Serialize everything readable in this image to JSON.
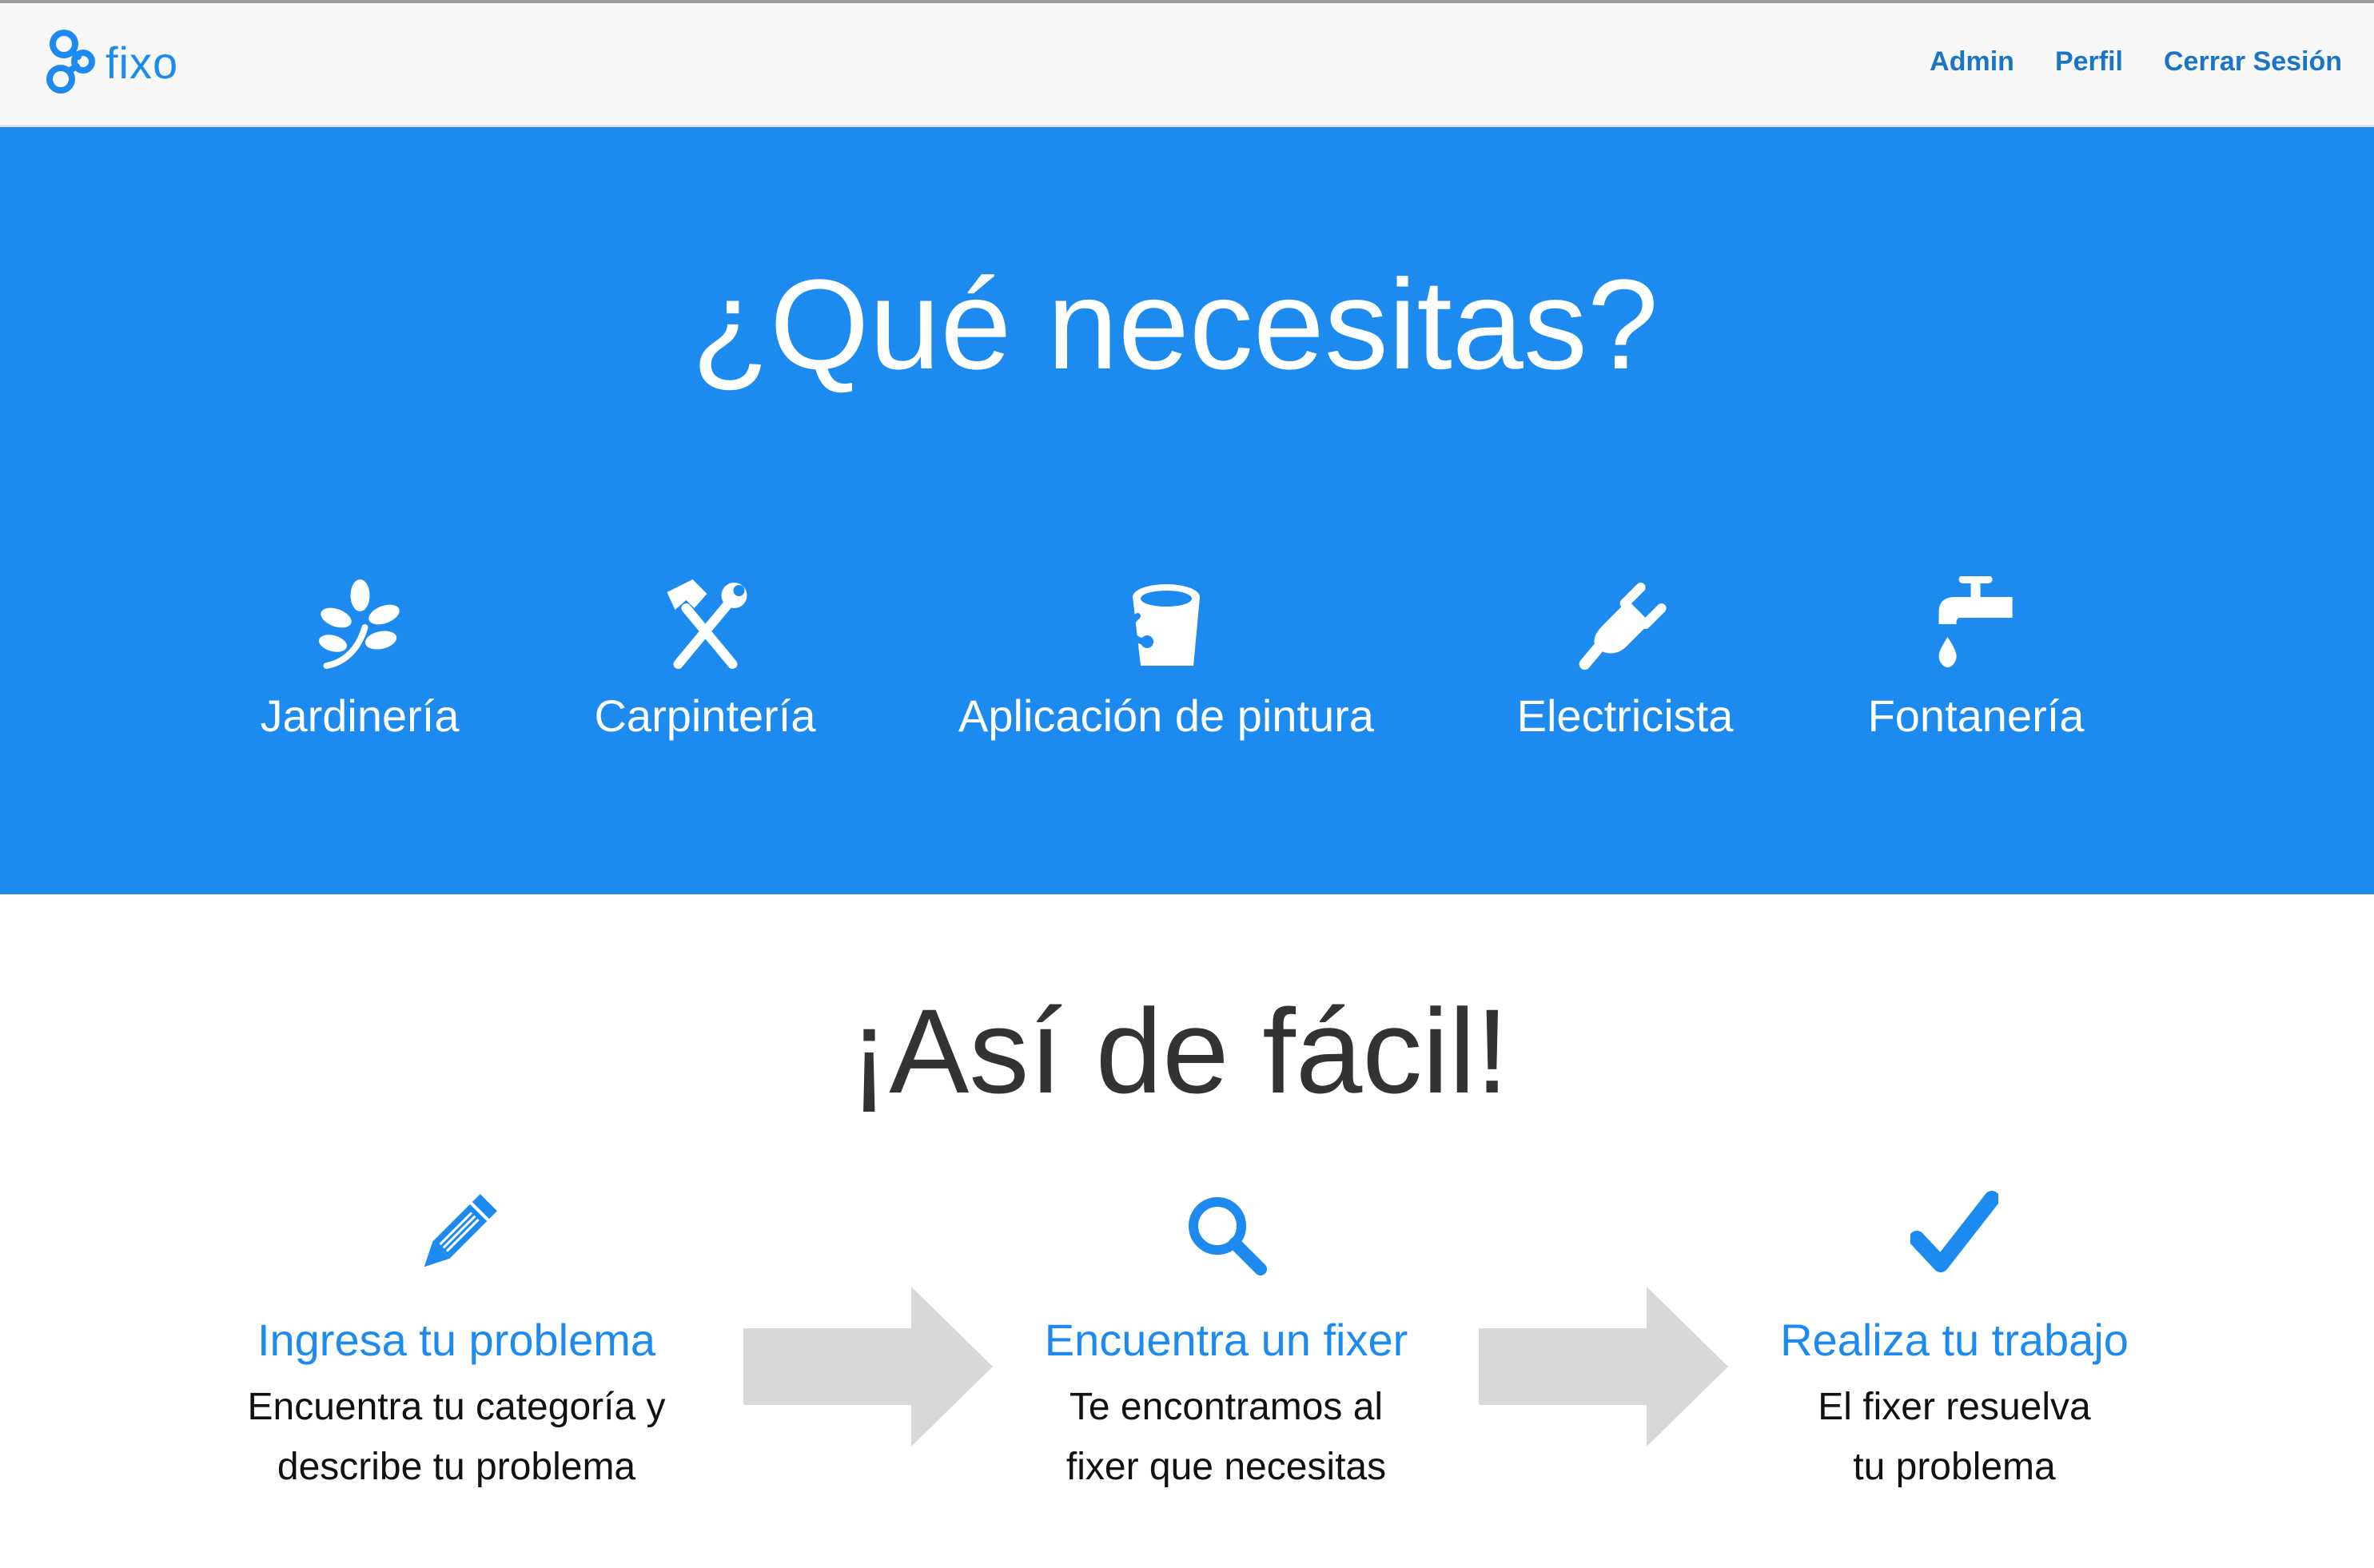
{
  "colors": {
    "brand": "#1c8aef",
    "nav_link": "#1a74c7",
    "navbar_bg": "#f8f8f8",
    "heading_dark": "#333333",
    "arrow": "#d8d8d8"
  },
  "brand": {
    "name": "fixo",
    "icon": "chain-link-logo-icon"
  },
  "nav": {
    "links": [
      {
        "label": "Admin"
      },
      {
        "label": "Perfil"
      },
      {
        "label": "Cerrar Sesión"
      }
    ]
  },
  "hero": {
    "title": "¿Qué necesitas?",
    "categories": [
      {
        "label": "Jardinería",
        "icon": "leaf-icon"
      },
      {
        "label": "Carpintería",
        "icon": "hammer-wrench-icon"
      },
      {
        "label": "Aplicación de pintura",
        "icon": "paint-bucket-icon"
      },
      {
        "label": "Electricista",
        "icon": "plug-icon"
      },
      {
        "label": "Fontanería",
        "icon": "faucet-icon"
      }
    ]
  },
  "steps": {
    "title": "¡Así de fácil!",
    "items": [
      {
        "title": "Ingresa tu problema",
        "desc_line1": "Encuentra tu categoría y",
        "desc_line2": "describe tu problema",
        "icon": "pencil-icon"
      },
      {
        "title": "Encuentra un fixer",
        "desc_line1": "Te encontramos al",
        "desc_line2": "fixer que necesitas",
        "icon": "search-icon"
      },
      {
        "title": "Realiza tu trabajo",
        "desc_line1": "El fixer resuelva",
        "desc_line2": "tu problema",
        "icon": "checkmark-icon"
      }
    ]
  }
}
